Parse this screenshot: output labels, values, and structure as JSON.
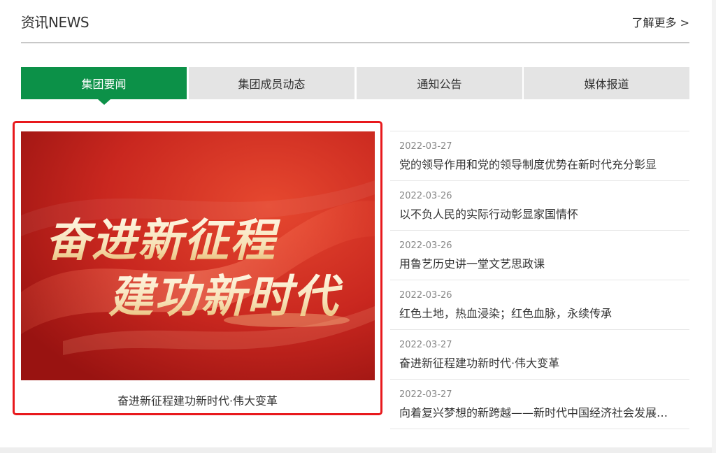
{
  "header": {
    "title": "资讯NEWS",
    "more_label": "了解更多 >"
  },
  "tabs": [
    {
      "label": "集团要闻",
      "active": true
    },
    {
      "label": "集团成员动态",
      "active": false
    },
    {
      "label": "通知公告",
      "active": false
    },
    {
      "label": "媒体报道",
      "active": false
    }
  ],
  "feature": {
    "image_line1": "奋进新征程",
    "image_line2": "建功新时代",
    "caption": "奋进新征程建功新时代·伟大变革"
  },
  "news": [
    {
      "date": "2022-03-27",
      "title": "党的领导作用和党的领导制度优势在新时代充分彰显"
    },
    {
      "date": "2022-03-26",
      "title": "以不负人民的实际行动彰显家国情怀"
    },
    {
      "date": "2022-03-26",
      "title": "用鲁艺历史讲一堂文艺思政课"
    },
    {
      "date": "2022-03-26",
      "title": "红色土地，热血浸染；红色血脉，永续传承"
    },
    {
      "date": "2022-03-27",
      "title": "奋进新征程建功新时代·伟大变革"
    },
    {
      "date": "2022-03-27",
      "title": "向着复兴梦想的新跨越——新时代中国经济社会发展…"
    }
  ],
  "colors": {
    "accent_green": "#0c9148",
    "highlight_red": "#e8191d",
    "banner_red": "#c7261f"
  }
}
